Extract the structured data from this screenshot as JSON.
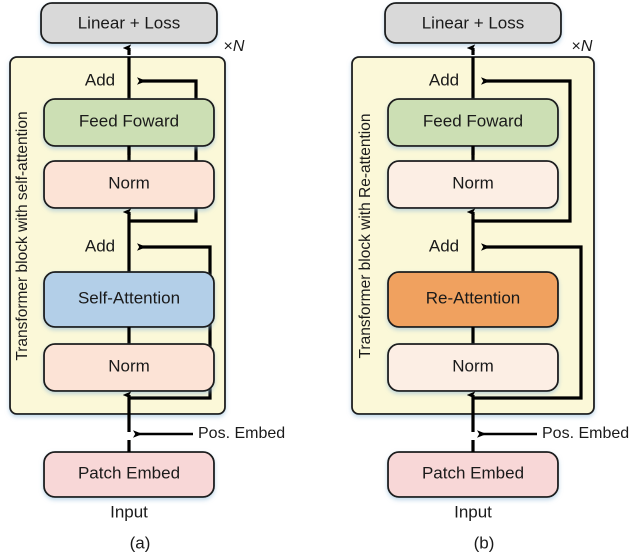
{
  "figure": {
    "caption_a": "(a)",
    "caption_b": "(b)",
    "repeat_label_prefix": "×",
    "repeat_label_symbol": "N"
  },
  "panel_a": {
    "vertical_label": "Transformer block with self-attention",
    "top_box": "Linear + Loss",
    "add_top": "Add",
    "feed_forward": "Feed Foward",
    "norm_upper": "Norm",
    "add_lower": "Add",
    "attention": "Self-Attention",
    "norm_lower": "Norm",
    "pos_embed": "Pos. Embed",
    "patch_embed": "Patch Embed",
    "input": "Input",
    "caption": "(a)"
  },
  "panel_b": {
    "vertical_label": "Transformer block with Re-attention",
    "top_box": "Linear + Loss",
    "add_top": "Add",
    "feed_forward": "Feed Foward",
    "norm_upper": "Norm",
    "add_lower": "Add",
    "attention": "Re-Attention",
    "norm_lower": "Norm",
    "pos_embed": "Pos. Embed",
    "patch_embed": "Patch Embed",
    "input": "Input",
    "caption": "(b)"
  },
  "colors": {
    "linear_loss_fill": "#d9d9d9",
    "panel_fill": "#fbf8d8",
    "feed_forward_fill": "#ccdfb4",
    "norm_fill": "#fce3d6",
    "norm_light_fill": "#fceee4",
    "self_attention_fill": "#b3cfe8",
    "re_attention_fill": "#f0a濃",
    "re_attention_fill_hex": "#f0a15e",
    "patch_embed_fill": "#f8d7d7",
    "stroke": "#1a1a1a",
    "wire": "#000000",
    "background": "#ffffff"
  }
}
